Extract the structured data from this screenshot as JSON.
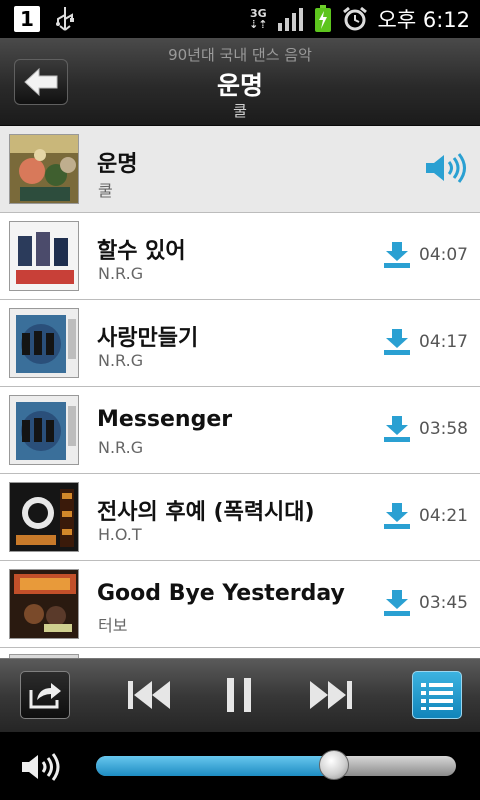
{
  "status_bar": {
    "notification_count": "1",
    "network": "3G",
    "time": "오후 6:12"
  },
  "header": {
    "playlist": "90년대 국내 댄스 음악",
    "title": "운명",
    "artist": "쿨"
  },
  "songs": [
    {
      "title": "운명",
      "artist": "쿨",
      "duration": "",
      "playing": true
    },
    {
      "title": "할수 있어",
      "artist": "N.R.G",
      "duration": "04:07",
      "playing": false
    },
    {
      "title": "사랑만들기",
      "artist": "N.R.G",
      "duration": "04:17",
      "playing": false
    },
    {
      "title": "Messenger",
      "artist": "N.R.G",
      "duration": "03:58",
      "playing": false
    },
    {
      "title": "전사의 후예 (폭력시대)",
      "artist": "H.O.T",
      "duration": "04:21",
      "playing": false
    },
    {
      "title": "Good Bye Yesterday",
      "artist": "터보",
      "duration": "03:45",
      "playing": false
    }
  ],
  "volume": {
    "level": 0.66
  },
  "colors": {
    "accent": "#1e9ad6",
    "icon_blue": "#2aa0d2"
  },
  "icons": {
    "back": "back-arrow-icon",
    "download": "download-icon",
    "playing": "speaker-icon",
    "share": "share-icon",
    "prev": "skip-previous-icon",
    "pause": "pause-icon",
    "next": "skip-next-icon",
    "playlist": "playlist-icon",
    "volume": "volume-icon"
  }
}
